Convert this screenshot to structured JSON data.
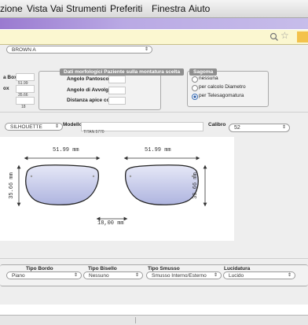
{
  "menu": [
    "zione",
    "Vista",
    "Vai",
    "Strumenti",
    "Preferiti",
    "Finestra",
    "Aiuto"
  ],
  "brand_select": "BROWN A",
  "left_fields": [
    {
      "label": "a Box",
      "value": "51.99"
    },
    {
      "label": "ox",
      "value": "35.66"
    },
    {
      "label": "",
      "value": "18"
    }
  ],
  "montatura": {
    "title": "Dati morfologici Paziente sulla montatura scelta",
    "fields": [
      "Angolo Pantoscopico",
      "Angolo di Avvolgimento",
      "Distanza apice corneale"
    ]
  },
  "sagoma": {
    "title": "Sagoma",
    "options": [
      "nessuna",
      "per calcolo Diametro",
      "per Telesagomatura"
    ],
    "selected": 2
  },
  "frame_type": "SILHOUETTE",
  "modello": {
    "label": "Modello",
    "value": "TITAN 5770"
  },
  "calibro": {
    "label": "Calibro",
    "value": "52"
  },
  "diagram": {
    "left_width": "51.99 mm",
    "right_width": "51.99 mm",
    "height": "35.66 mm",
    "bridge": "18,00 mm"
  },
  "bottom": {
    "labels": [
      "Tipo Bordo",
      "Tipo Bisello",
      "Tipo Smusso",
      "Lucidatura"
    ],
    "values": [
      "Piano",
      "Nessuno",
      "Smusso Interno/Esterno",
      "Lucido"
    ]
  }
}
